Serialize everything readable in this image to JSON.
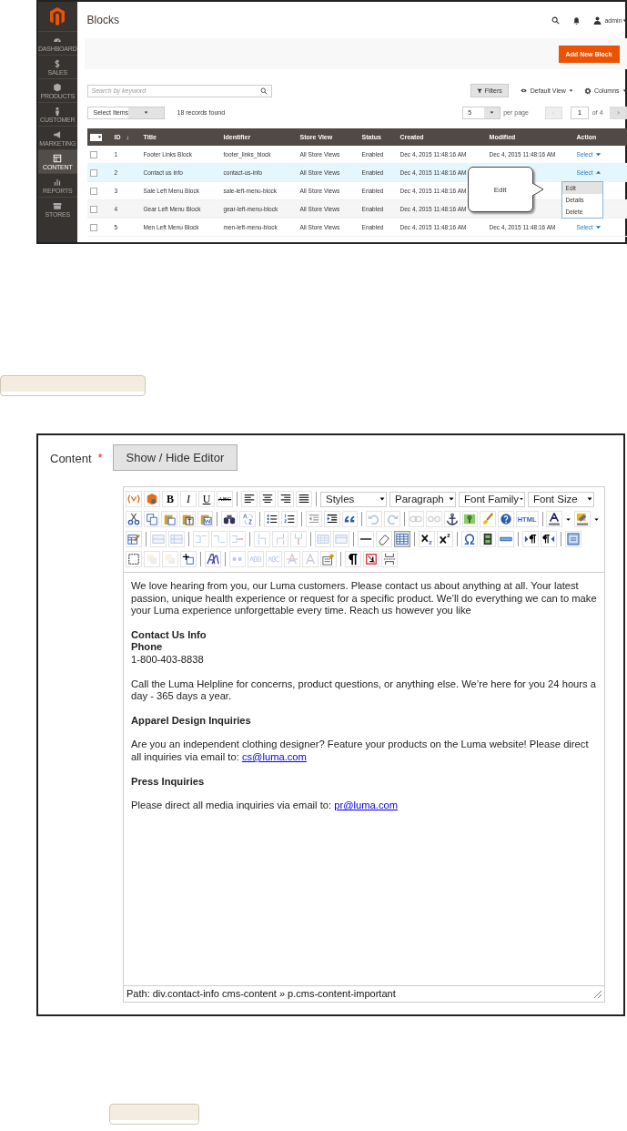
{
  "admin_screenshot": {
    "sidebar": [
      {
        "label": "DASHBOARD",
        "selected": false
      },
      {
        "label": "SALES",
        "selected": false
      },
      {
        "label": "PRODUCTS",
        "selected": false
      },
      {
        "label": "CUSTOMER",
        "selected": false
      },
      {
        "label": "MARKETING",
        "selected": false
      },
      {
        "label": "CONTENT",
        "selected": true
      },
      {
        "label": "REPORTS",
        "selected": false
      },
      {
        "label": "STORES",
        "selected": false
      }
    ],
    "page_title": "Blocks",
    "user": "admin",
    "add_button": "Add New Block",
    "search": {
      "placeholder": "Search by keyword"
    },
    "filters": "Filters",
    "view": "Default View",
    "columns_button": "Columns",
    "mass_action": "Select Items",
    "records": "18 records found",
    "per_page": {
      "value": "5",
      "label": "per page"
    },
    "page": {
      "value": "1",
      "of": "of 4"
    },
    "table": {
      "select_all_checked": false,
      "columns": [
        "ID",
        "Title",
        "Identifier",
        "Store View",
        "Status",
        "Created",
        "Modified",
        "Action"
      ],
      "sort_mark": "↓",
      "rows": [
        {
          "id": "1",
          "title": "Footer Links Block",
          "identifier": "footer_links_block",
          "store_view": "All Store Views",
          "status": "Enabled",
          "created": "Dec 4, 2015 11:48:16 AM",
          "modified": "Dec 4, 2015 11:48:16 AM",
          "action": "Select",
          "selected": false,
          "expanded": false
        },
        {
          "id": "2",
          "title": "Contact us info",
          "identifier": "contact-us-info",
          "store_view": "All Store Views",
          "status": "Enabled",
          "created": "Dec 4, 2015 11:48:16 AM",
          "action": "Select",
          "selected": true,
          "expanded": true
        },
        {
          "id": "3",
          "title": "Sale Left Menu Block",
          "identifier": "sale-left-menu-block",
          "store_view": "All Store Views",
          "status": "Enabled",
          "created": "Dec 4, 2015 11:48:16 AM",
          "selected": false
        },
        {
          "id": "4",
          "title": "Gear Left Menu Block",
          "identifier": "gear-left-menu-block",
          "store_view": "All Store Views",
          "status": "Enabled",
          "created": "Dec 4, 2015 11:48:16 AM",
          "selected": false
        },
        {
          "id": "5",
          "title": "Men Left Menu Block",
          "identifier": "men-left-menu-block",
          "store_view": "All Store Views",
          "status": "Enabled",
          "created": "Dec 4, 2015 11:48:16 AM",
          "modified": "Dec 4, 2015 11:48:16 AM",
          "action": "Select",
          "selected": false,
          "expanded": false
        }
      ]
    },
    "action_menu": [
      {
        "label": "Edit",
        "selected": true
      },
      {
        "label": "Details",
        "selected": false
      },
      {
        "label": "Delete",
        "selected": false
      }
    ],
    "callout": "Edit"
  },
  "editor_screenshot": {
    "field_label": "Content",
    "required_mark": "*",
    "toggle_button": "Show / Hide Editor",
    "toolbar_rows": [
      [
        {
          "kind": "icon"
        },
        {
          "kind": "icon"
        },
        {
          "kind": "text",
          "text": "B"
        },
        {
          "kind": "text",
          "text": "I"
        },
        {
          "kind": "text",
          "text": "U"
        },
        {
          "kind": "text",
          "text": "ABC"
        },
        {
          "kind": "sep"
        },
        {
          "kind": "icon"
        },
        {
          "kind": "icon"
        },
        {
          "kind": "icon"
        },
        {
          "kind": "icon"
        },
        {
          "kind": "sep"
        },
        {
          "kind": "select",
          "label": "Styles"
        },
        {
          "kind": "select",
          "label": "Paragraph"
        },
        {
          "kind": "select",
          "label": "Font Family"
        },
        {
          "kind": "select",
          "label": "Font Size"
        }
      ],
      [
        {
          "kind": "icon"
        },
        {
          "kind": "icon"
        },
        {
          "kind": "icon"
        },
        {
          "kind": "icon"
        },
        {
          "kind": "icon"
        },
        {
          "kind": "sep"
        },
        {
          "kind": "icon"
        },
        {
          "kind": "icon"
        },
        {
          "kind": "sep"
        },
        {
          "kind": "icon"
        },
        {
          "kind": "icon"
        },
        {
          "kind": "sep"
        },
        {
          "kind": "icon"
        },
        {
          "kind": "icon"
        },
        {
          "kind": "icon"
        },
        {
          "kind": "sep"
        },
        {
          "kind": "icon",
          "disabled": true
        },
        {
          "kind": "icon",
          "disabled": true
        },
        {
          "kind": "sep"
        },
        {
          "kind": "icon",
          "disabled": true
        },
        {
          "kind": "icon",
          "disabled": true
        },
        {
          "kind": "icon"
        },
        {
          "kind": "icon"
        },
        {
          "kind": "icon"
        },
        {
          "kind": "icon"
        },
        {
          "kind": "text",
          "text": "HTML"
        },
        {
          "kind": "sep"
        },
        {
          "kind": "icon"
        },
        {
          "kind": "icon"
        },
        {
          "kind": "icon"
        },
        {
          "kind": "icon"
        }
      ],
      [
        {
          "kind": "icon"
        },
        {
          "kind": "sep"
        },
        {
          "kind": "icon",
          "disabled": true
        },
        {
          "kind": "icon",
          "disabled": true
        },
        {
          "kind": "sep"
        },
        {
          "kind": "icon",
          "disabled": true
        },
        {
          "kind": "icon",
          "disabled": true
        },
        {
          "kind": "icon",
          "disabled": true
        },
        {
          "kind": "sep"
        },
        {
          "kind": "icon",
          "disabled": true
        },
        {
          "kind": "icon",
          "disabled": true
        },
        {
          "kind": "icon",
          "disabled": true
        },
        {
          "kind": "sep"
        },
        {
          "kind": "icon",
          "disabled": true
        },
        {
          "kind": "icon",
          "disabled": true
        },
        {
          "kind": "sep"
        },
        {
          "kind": "icon"
        },
        {
          "kind": "icon"
        },
        {
          "kind": "icon",
          "active": true
        },
        {
          "kind": "sep"
        },
        {
          "kind": "icon"
        },
        {
          "kind": "icon"
        },
        {
          "kind": "sep"
        },
        {
          "kind": "icon"
        },
        {
          "kind": "icon"
        },
        {
          "kind": "icon"
        },
        {
          "kind": "sep"
        },
        {
          "kind": "icon"
        },
        {
          "kind": "icon"
        },
        {
          "kind": "sep"
        },
        {
          "kind": "icon"
        }
      ],
      [
        {
          "kind": "icon"
        },
        {
          "kind": "icon",
          "disabled": true
        },
        {
          "kind": "icon",
          "disabled": true
        },
        {
          "kind": "icon"
        },
        {
          "kind": "sep"
        },
        {
          "kind": "icon"
        },
        {
          "kind": "sep"
        },
        {
          "kind": "icon",
          "disabled": true
        },
        {
          "kind": "icon",
          "disabled": true
        },
        {
          "kind": "icon",
          "disabled": true
        },
        {
          "kind": "icon",
          "disabled": true
        },
        {
          "kind": "icon",
          "disabled": true
        },
        {
          "kind": "icon"
        },
        {
          "kind": "sep"
        },
        {
          "kind": "icon"
        },
        {
          "kind": "icon"
        },
        {
          "kind": "icon"
        }
      ]
    ],
    "content": [
      {
        "kind": "para",
        "lines": [
          {
            "text": "We love hearing from you, our Luma customers. Please contact us about anything at all. Your latest passion, unique health experience or request for a specific product. We’ll do everything we can to make your Luma experience unforgettable every time. Reach us however you like"
          }
        ]
      },
      {
        "kind": "para",
        "lines": [
          {
            "text": "Contact Us Info",
            "bold": true
          },
          {
            "text": "Phone",
            "bold": true
          },
          {
            "text": "1-800-403-8838"
          }
        ]
      },
      {
        "kind": "para",
        "lines": [
          {
            "text": "Call the Luma Helpline for concerns, product questions, or anything else. We’re here for you 24 hours a day - 365 days a year."
          }
        ]
      },
      {
        "kind": "para",
        "lines": [
          {
            "text": "Apparel Design Inquiries",
            "bold": true
          }
        ]
      },
      {
        "kind": "para",
        "lines": [
          {
            "text": "Are you an independent clothing designer? Feature your products on the Luma website! Please direct all inquiries via email to: ",
            "link": "cs@luma.com"
          }
        ]
      },
      {
        "kind": "para",
        "lines": [
          {
            "text": "Press Inquiries",
            "bold": true
          }
        ]
      },
      {
        "kind": "para",
        "lines": [
          {
            "text": "Please direct all media inquiries via email to: ",
            "link": "pr@luma.com"
          }
        ]
      }
    ],
    "path": "Path: div.contact-info cms-content » p.cms-content-important"
  }
}
